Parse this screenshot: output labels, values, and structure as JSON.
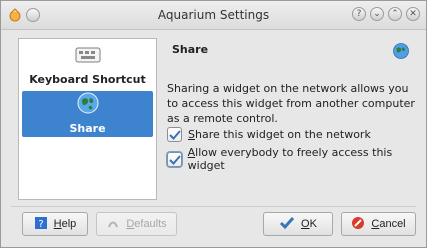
{
  "window": {
    "title": "Aquarium Settings",
    "buttons": [
      "?",
      "⌄",
      "⌃",
      "✕"
    ]
  },
  "sidebar": {
    "items": [
      {
        "label": "Keyboard Shortcut",
        "icon": "keyboard-icon",
        "selected": false
      },
      {
        "label": "Share",
        "icon": "globe-icon",
        "selected": true
      }
    ]
  },
  "content": {
    "title": "Share",
    "description": "Sharing a widget on the network allows you to access this widget from another computer as a remote control.",
    "checkboxes": [
      {
        "label_mnemonic": "S",
        "label_rest": "hare this widget on the network",
        "checked": true
      },
      {
        "label_mnemonic": "A",
        "label_rest": "llow everybody to freely access this widget",
        "checked": true
      }
    ]
  },
  "footer": {
    "help": {
      "mnemonic": "H",
      "rest": "elp"
    },
    "defaults": {
      "mnemonic": "D",
      "rest": "efaults",
      "enabled": false
    },
    "ok": {
      "mnemonic": "O",
      "rest": "K"
    },
    "cancel": {
      "mnemonic": "C",
      "rest": "ancel"
    }
  },
  "colors": {
    "selection": "#3d83cd",
    "check": "#3a73b8",
    "cancel_icon": "#d93a2b"
  }
}
